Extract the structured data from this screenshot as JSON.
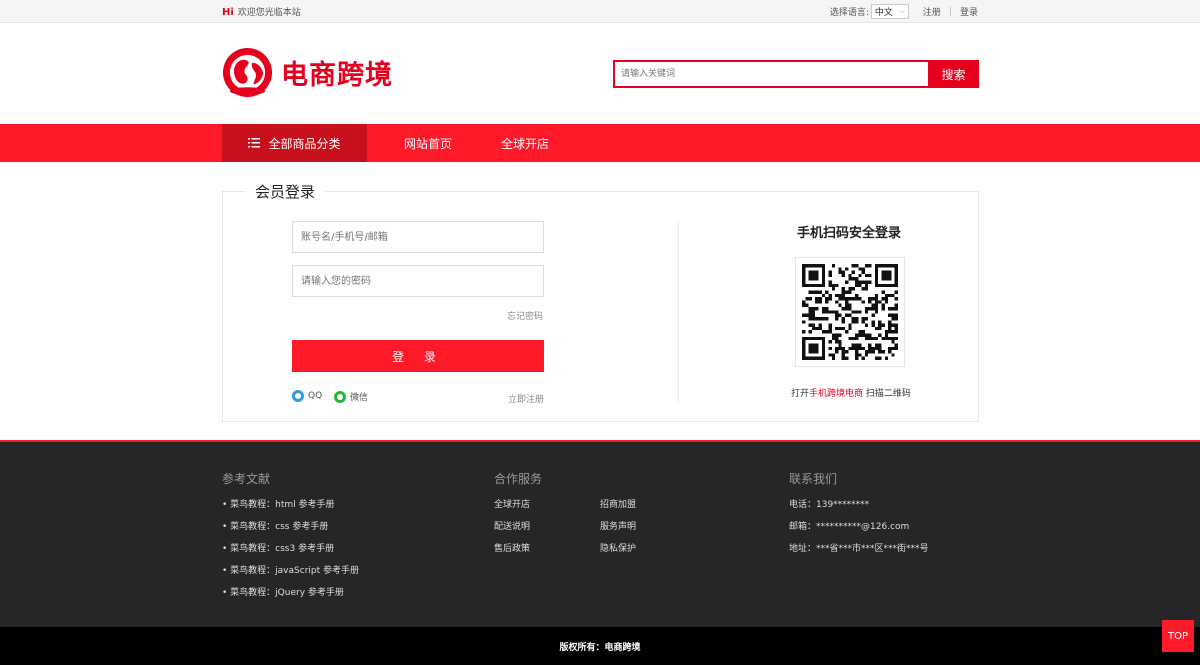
{
  "topbar": {
    "hi": "Hi",
    "welcome": "欢迎您光临本站",
    "lang_label": "选择语言:",
    "lang_value": "中文",
    "register": "注册",
    "divider": "|",
    "login": "登录"
  },
  "header": {
    "logo_text": "电商跨境",
    "search_placeholder": "请输入关键词",
    "search_button": "搜索"
  },
  "nav": {
    "all_categories": "全部商品分类",
    "links": [
      "网站首页",
      "全球开店"
    ]
  },
  "login": {
    "title": "会员登录",
    "account_placeholder": "账号名/手机号/邮箱",
    "password_placeholder": "请输入您的密码",
    "forgot": "忘记密码",
    "submit": "登 录",
    "qq": "QQ",
    "wechat": "微信",
    "register": "立即注册"
  },
  "qr": {
    "title": "手机扫码安全登录",
    "tip_prefix": "打开",
    "tip_highlight": "手机跨境电商",
    "tip_suffix": " 扫描二维码"
  },
  "footer": {
    "ref_title": "参考文献",
    "refs": [
      "• 菜鸟教程：html 参考手册",
      "• 菜鸟教程：css 参考手册",
      "• 菜鸟教程：css3 参考手册",
      "• 菜鸟教程：javaScript 参考手册",
      "• 菜鸟教程：jQuery 参考手册"
    ],
    "service_title": "合作服务",
    "services": [
      "全球开店",
      "招商加盟",
      "配送说明",
      "服务声明",
      "售后政策",
      "隐私保护"
    ],
    "contact_title": "联系我们",
    "contacts": [
      "电话：139********",
      "邮箱：**********@126.com",
      "地址：***省***市***区***街***号"
    ],
    "copyright": "版权所有：电商跨境",
    "top": "TOP"
  },
  "colors": {
    "brand_red": "#e6001e",
    "nav_red": "#ff1a2a",
    "footer_bg": "#252628"
  }
}
